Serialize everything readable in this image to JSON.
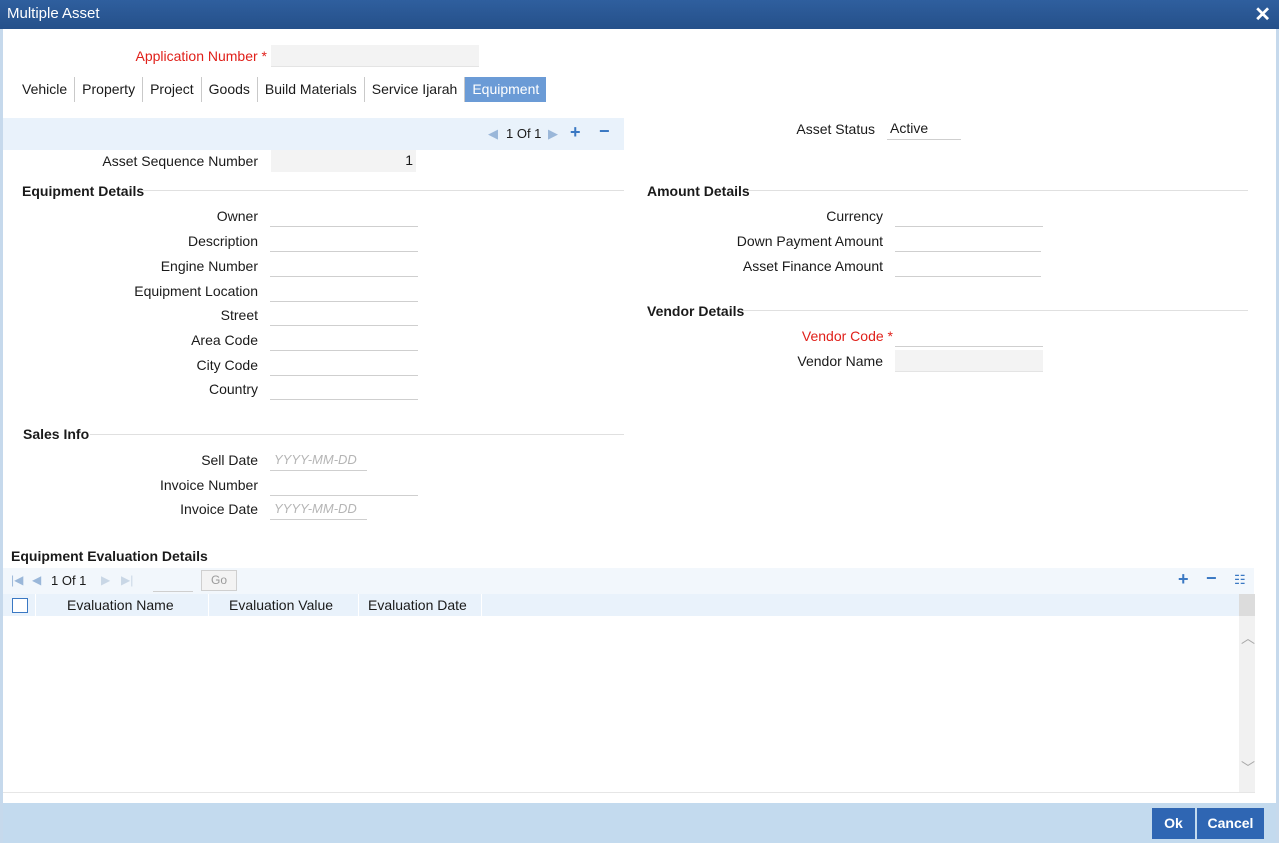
{
  "window": {
    "title": "Multiple Asset",
    "close_symbol": "✕"
  },
  "application": {
    "label": "Application Number",
    "required": "*",
    "value": ""
  },
  "tabs": [
    {
      "label": "Vehicle"
    },
    {
      "label": "Property"
    },
    {
      "label": "Project"
    },
    {
      "label": "Goods"
    },
    {
      "label": "Build Materials"
    },
    {
      "label": "Service Ijarah"
    },
    {
      "label": "Equipment",
      "active": true
    }
  ],
  "record_nav": {
    "page_text": "1 Of 1"
  },
  "asset_status": {
    "label": "Asset Status",
    "value": "Active"
  },
  "asset_sequence": {
    "label": "Asset Sequence Number",
    "value": "1"
  },
  "equipment_details": {
    "heading": "Equipment Details",
    "owner": "Owner",
    "description": "Description",
    "engine_number": "Engine Number",
    "equipment_location": "Equipment Location",
    "street": "Street",
    "area_code": "Area Code",
    "city_code": "City Code",
    "country": "Country"
  },
  "amount_details": {
    "heading": "Amount Details",
    "currency": "Currency",
    "down_payment": "Down Payment Amount",
    "asset_finance": "Asset Finance Amount"
  },
  "vendor_details": {
    "heading": "Vendor Details",
    "vendor_code": "Vendor Code",
    "required": "*",
    "vendor_name": "Vendor Name"
  },
  "sales_info": {
    "heading": "Sales Info",
    "sell_date": "Sell Date",
    "invoice_number": "Invoice Number",
    "invoice_date": "Invoice Date",
    "date_placeholder": "YYYY-MM-DD"
  },
  "evaluation": {
    "heading": "Equipment Evaluation Details",
    "page_text": "1 Of 1",
    "go_label": "Go",
    "columns": [
      "Evaluation Name",
      "Evaluation Value",
      "Evaluation Date"
    ]
  },
  "footer": {
    "ok_label": "Ok",
    "cancel_label": "Cancel"
  },
  "colors": {
    "titlebar": "#2f5f9e",
    "active_tab": "#6b9bd6",
    "required": "#e0201a",
    "button": "#2f66b3",
    "footer": "#c3daee"
  }
}
